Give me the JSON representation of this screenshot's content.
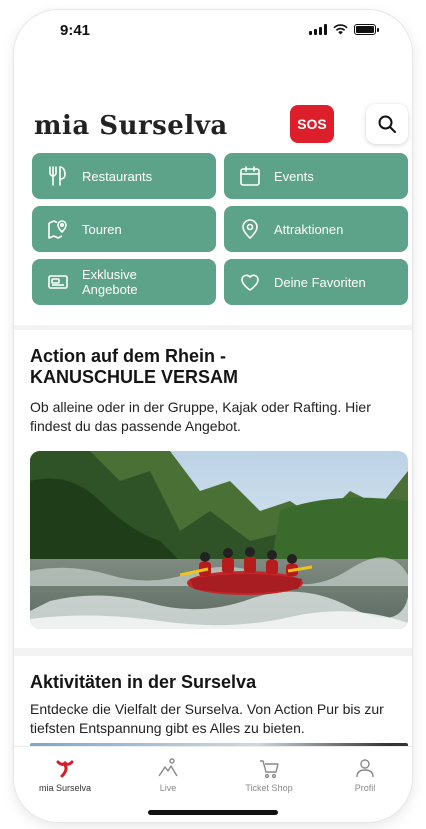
{
  "status_bar": {
    "time": "9:41"
  },
  "header": {
    "app_title": "mia Surselva",
    "sos_label": "SOS"
  },
  "categories": [
    {
      "label": "Restaurants",
      "icon": "cutlery-icon"
    },
    {
      "label": "Events",
      "icon": "calendar-icon"
    },
    {
      "label": "Touren",
      "icon": "map-icon"
    },
    {
      "label": "Attraktionen",
      "icon": "location-pin-icon"
    },
    {
      "label": "Exklusive Angebote",
      "icon": "voucher-icon"
    },
    {
      "label": "Deine Favoriten",
      "icon": "heart-icon"
    }
  ],
  "featured": {
    "title_line1": "Action auf dem Rhein -",
    "title_line2": "KANUSCHULE VERSAM",
    "description": "Ob alleine oder in der Gruppe, Kajak oder Rafting. Hier findest du das passende Angebot."
  },
  "activities": {
    "title": "Aktivitäten in der Surselva",
    "description": "Entdecke die Vielfalt der Surselva. Von Action Pur bis zur tiefsten Entspannung gibt es Alles zu bieten."
  },
  "tabbar": [
    {
      "label": "mia Surselva",
      "icon": "mia-logo-icon",
      "active": true
    },
    {
      "label": "Live",
      "icon": "mountain-icon",
      "active": false
    },
    {
      "label": "Ticket Shop",
      "icon": "cart-icon",
      "active": false
    },
    {
      "label": "Profil",
      "icon": "person-icon",
      "active": false
    }
  ],
  "colors": {
    "accent_green": "#5da389",
    "sos_red": "#dc1f2b",
    "brand_red": "#d41e2b"
  }
}
